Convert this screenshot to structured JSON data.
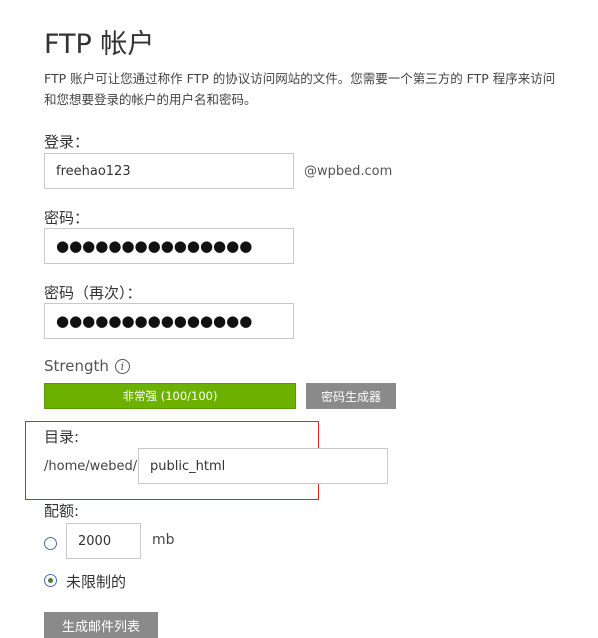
{
  "page": {
    "title": "FTP 帐户",
    "intro_line1": "FTP 账户可让您通过称作 FTP 的协议访问网站的文件。您需要一个第三方的 FTP 程序来访问",
    "intro_line2": "和您想要登录的帐户的用户名和密码。"
  },
  "form": {
    "login_label": "登录：",
    "login_value": "freehao123",
    "login_suffix": "@wpbed.com",
    "password_label": "密码：",
    "password_value": "●●●●●●●●●●●●●●●",
    "password_confirm_label": "密码（再次）：",
    "password_confirm_value": "●●●●●●●●●●●●●●●",
    "strength_label": "Strength",
    "strength_text": "非常强 (100/100)",
    "strength_score": 100,
    "strength_color": "#6cb000",
    "generator_button": "密码生成器",
    "directory_label": "目录:",
    "directory_prefix": "/home/webed/",
    "directory_value": "public_html",
    "quota_label": "配额:",
    "quota_value": "2000",
    "quota_unit": "mb",
    "unlimited_label": "未限制的",
    "quota_selected": "unlimited",
    "create_button": "生成邮件列表"
  },
  "colors": {
    "highlight_border": "#d42a2a",
    "button_gray": "#8a8a8a"
  }
}
